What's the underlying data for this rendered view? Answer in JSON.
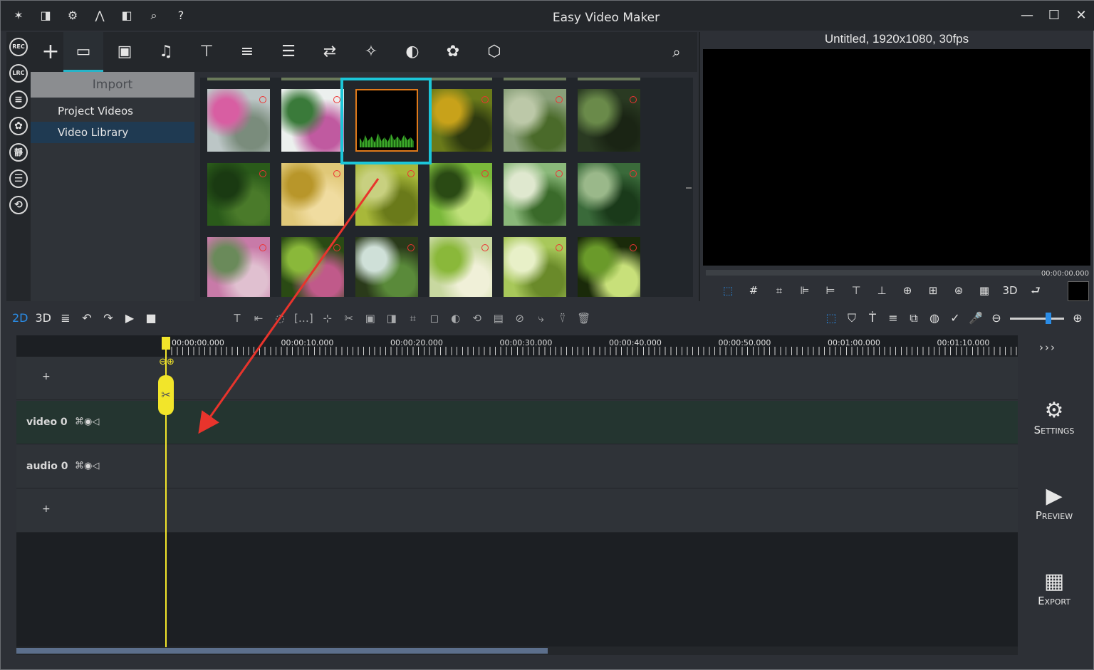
{
  "window": {
    "title": "Easy Video Maker",
    "minimize": "—",
    "maximize": "☐",
    "close": "✕"
  },
  "titlebar_icons": [
    "magic-wand-icon",
    "book-icon",
    "gear-icon",
    "theme-icon",
    "layout-icon",
    "search-icon",
    "help-icon"
  ],
  "titlebar_glyphs": [
    "✶",
    "◨",
    "⚙",
    "⋀",
    "◧",
    "⌕",
    "?"
  ],
  "left_toolbar": [
    "REC",
    "LRC",
    "≡",
    "✿",
    "靜",
    "☰",
    "⟲"
  ],
  "media_toolbar": {
    "add": "+",
    "tabs": [
      "▭",
      "▣",
      "♫",
      "⊤",
      "≡",
      "☰",
      "⇄",
      "✧",
      "◐",
      "✿",
      "⬡"
    ],
    "search": "⌕"
  },
  "library": {
    "import_label": "Import",
    "items": [
      "Project Videos",
      "Video Library"
    ],
    "selected_index": 1
  },
  "thumbnails": [
    {
      "colors": [
        "#bcc6c6",
        "#d85ea2",
        "#7a8c7c"
      ]
    },
    {
      "colors": [
        "#ecf0ee",
        "#3a7a3a",
        "#c05aa0"
      ]
    },
    {
      "colors": [
        "#000000",
        "#000000",
        "#000000"
      ],
      "selected": true
    },
    {
      "colors": [
        "#6a7a1a",
        "#c8a21a",
        "#2e3a10"
      ]
    },
    {
      "colors": [
        "#8aa07a",
        "#bcc8a8",
        "#4a6a2a"
      ]
    },
    {
      "colors": [
        "#2a3a22",
        "#6a8a4a",
        "#1a2414"
      ]
    },
    {
      "colors": [
        "#2a5a1a",
        "#1a3a12",
        "#4a7a2a"
      ]
    },
    {
      "colors": [
        "#e0c878",
        "#b8962a",
        "#f0dca0"
      ]
    },
    {
      "colors": [
        "#a8b83a",
        "#c8d080",
        "#6a7a1a"
      ]
    },
    {
      "colors": [
        "#7ab83a",
        "#2a4a14",
        "#bfe07a"
      ]
    },
    {
      "colors": [
        "#8ab87a",
        "#dfe8cf",
        "#3a6a2a"
      ]
    },
    {
      "colors": [
        "#3a6a3a",
        "#9ab88a",
        "#1a3a1a"
      ]
    },
    {
      "colors": [
        "#c87aa8",
        "#6a8a5a",
        "#e0c0d0"
      ]
    },
    {
      "colors": [
        "#2a4a14",
        "#8ab83a",
        "#c05a8a"
      ]
    },
    {
      "colors": [
        "#2a3a1a",
        "#cfe0d8",
        "#5a8a3a"
      ]
    },
    {
      "colors": [
        "#c8d8a0",
        "#8ab83a",
        "#f0f0d8"
      ]
    },
    {
      "colors": [
        "#a8c85a",
        "#e8f0c8",
        "#6a8a2a"
      ]
    },
    {
      "colors": [
        "#1a2a0a",
        "#6a9a2a",
        "#c8e07a"
      ]
    }
  ],
  "preview": {
    "title": "Untitled, 1920x1080, 30fps",
    "time": "00:00:00.000",
    "tools": [
      "⬚",
      "#",
      "⌗",
      "⊫",
      "⊨",
      "⊤",
      "⊥",
      "⊕",
      "⊞",
      "⊛",
      "▦",
      "3D",
      "⮐"
    ]
  },
  "timeline_toolbar": {
    "left": [
      "2D",
      "3D",
      "≣",
      "↶",
      "↷",
      "▶",
      "■"
    ],
    "middle": [
      "T",
      "⇤",
      "◌",
      "[…]",
      "⊹",
      "✂",
      "▣",
      "◨",
      "⌗",
      "◻",
      "◐",
      "⟲",
      "▤",
      "⊘",
      "⤷",
      "⍢",
      "🗑"
    ],
    "right": [
      "⬚",
      "⛉",
      "Ṫ",
      "≡",
      "⧉",
      "◍",
      "✓",
      "🎤",
      "⊖",
      "⊕"
    ]
  },
  "timeline": {
    "ruler_labels": [
      "00:00:00.000",
      "00:00:10.000",
      "00:00:20.000",
      "00:00:30.000",
      "00:00:40.000",
      "00:00:50.000",
      "00:01:00.000",
      "00:01:10.000"
    ],
    "tracks": [
      {
        "type": "add",
        "label": "+"
      },
      {
        "type": "video",
        "label": "video 0",
        "icons": "⌘◉◁"
      },
      {
        "type": "audio",
        "label": "audio 0",
        "icons": "⌘◉◁"
      },
      {
        "type": "add",
        "label": "+"
      }
    ],
    "playhead_zoom": "⊖⊕",
    "playhead_glyph": "✂"
  },
  "side_actions": {
    "more": "›››",
    "settings": {
      "icon": "⚙",
      "label": "Settings"
    },
    "preview": {
      "icon": "▶",
      "label": "Preview"
    },
    "export": {
      "icon": "▦",
      "label": "Export"
    }
  },
  "accent_color": "#27b4c8",
  "annotation_color": "#e8342c"
}
